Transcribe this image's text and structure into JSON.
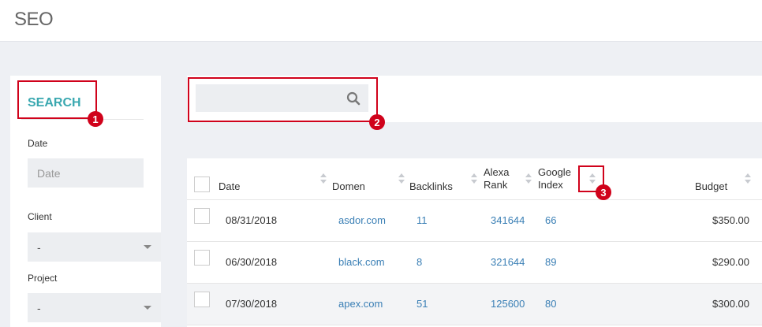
{
  "header": {
    "title": "SEO"
  },
  "search_panel": {
    "heading": "SEARCH",
    "date_label": "Date",
    "date_placeholder": "Date",
    "client_label": "Client",
    "client_value": "-",
    "project_label": "Project",
    "project_value": "-"
  },
  "search_bar": {
    "icon": "search-icon"
  },
  "table": {
    "columns": [
      {
        "key": "date",
        "label": "Date"
      },
      {
        "key": "domen",
        "label": "Domen"
      },
      {
        "key": "backlinks",
        "label": "Backlinks"
      },
      {
        "key": "alexa",
        "label": "Alexa Rank"
      },
      {
        "key": "google",
        "label": "Google Index"
      },
      {
        "key": "budget",
        "label": "Budget"
      }
    ],
    "rows": [
      {
        "date": "08/31/2018",
        "domen": "asdor.com",
        "backlinks": "11",
        "alexa": "341644",
        "google": "66",
        "budget": "$350.00"
      },
      {
        "date": "06/30/2018",
        "domen": "black.com",
        "backlinks": "8",
        "alexa": "321644",
        "google": "89",
        "budget": "$290.00"
      },
      {
        "date": "07/30/2018",
        "domen": "apex.com",
        "backlinks": "51",
        "alexa": "125600",
        "google": "80",
        "budget": "$300.00"
      }
    ]
  },
  "annotations": [
    "1",
    "2",
    "3"
  ],
  "colors": {
    "accent": "#3aa8b0",
    "link": "#3a7fb5",
    "callout": "#d0021b"
  }
}
